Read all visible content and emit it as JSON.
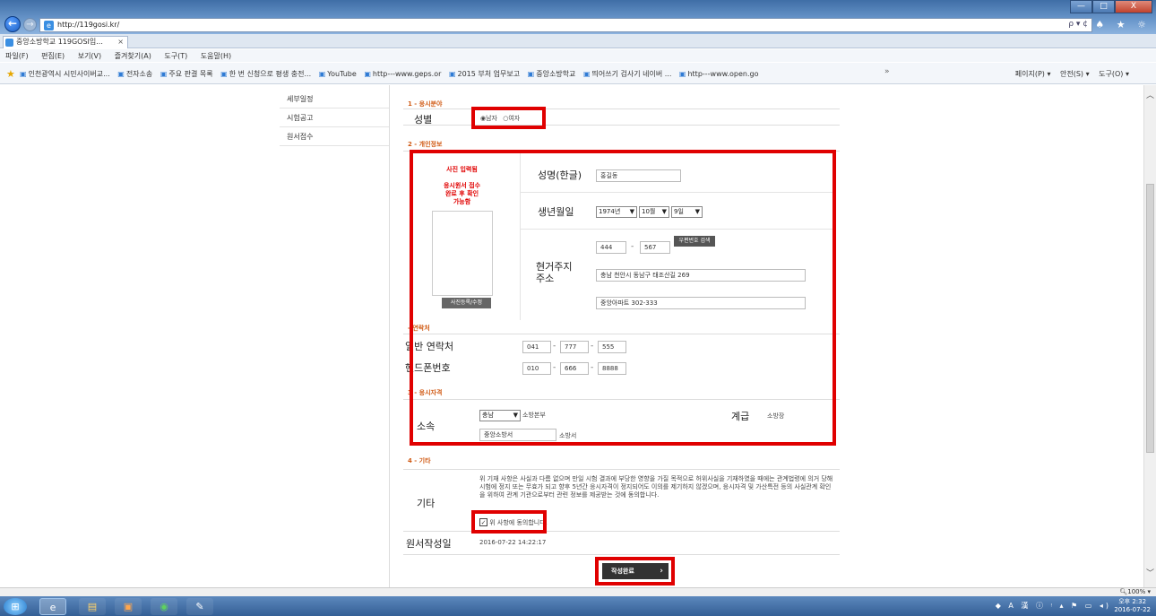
{
  "browser": {
    "url": "http://119gosi.kr/",
    "tab_title": "중앙소방학교 119GOSI입...",
    "tab_close": "×",
    "back_glyph": "←",
    "forward_glyph": "→",
    "addr_tools": "ρ ▾ ¢",
    "right_icons": "♠ ★ ☼",
    "win_min": "—",
    "win_max": "□",
    "win_close": "X",
    "menu": [
      "파일(F)",
      "편집(E)",
      "보기(V)",
      "즐겨찾기(A)",
      "도구(T)",
      "도움말(H)"
    ],
    "favorites": [
      "인천광역시 시민사이버교...",
      "전자소송",
      "주요 판결 목록",
      "한 번 신청으로 평생 충전...",
      "YouTube",
      "http---www.geps.or",
      "2015 부처 업무보고",
      "중앙소방학교",
      "띄어쓰기 검사기 네이버 ...",
      "http---www.open.go"
    ],
    "fav_more": "»",
    "commands": [
      "페이지(P) ▾",
      "안전(S) ▾",
      "도구(O) ▾"
    ]
  },
  "sidebar": {
    "items": [
      {
        "label": "세부일정"
      },
      {
        "label": "시험공고"
      },
      {
        "label": "원서접수"
      }
    ]
  },
  "form": {
    "section1": {
      "title": "1 - 응시분야",
      "gender_label": "성별",
      "gender_options": [
        "남자",
        "여자"
      ],
      "gender_selected": "남자"
    },
    "section2": {
      "title": "2 - 개인정보",
      "photo_note": "사진 입력됨\n\n응시원서 접수\n완료 후 확인\n가능함",
      "photo_button": "사진등록/수정",
      "name_label": "성명(한글)",
      "name_value": "홍길동",
      "birth_label": "생년월일",
      "birth_year": "1974년",
      "birth_month": "10월",
      "birth_day": "9일",
      "address_label": "현거주지\n주소",
      "zip1": "444",
      "zip2": "567",
      "zip_button": "우편번호 검색",
      "address1": "충남 천안시 동남구 태조산길 269",
      "address2": "중앙아파트 302-333"
    },
    "contact": {
      "title": "- 연락처",
      "phone_label": "일반 연락처",
      "phone": [
        "041",
        "777",
        "555"
      ],
      "mobile_label": "핸드폰번호",
      "mobile": [
        "010",
        "666",
        "8888"
      ]
    },
    "section3": {
      "title": "3 - 응시자격",
      "affiliation_label": "소속",
      "province": "충남",
      "hq_suffix": "소방본부",
      "station": "중앙소방서",
      "station_suffix": "소방서",
      "rank_label": "계급",
      "rank_value": "소방장"
    },
    "section4": {
      "title": "4 - 기타",
      "etc_label": "기타",
      "notice": "위 기재 사항은 사실과 다름 없으며 만일 시험 결과에 부당한 영향을 가질 목적으로 허위사실을 기재하였을 때에는 관계법령에 의거 당해 시험에 정지 또는 무효가 되고 향후 5년간 응시자격이 정지되어도 이의를 제기하지 않겠으며, 응시자격 및 가산특전 등의 사실관계 확인을 위하여 관계 기관으로부터 관련 정보를 제공받는 것에 동의합니다.",
      "agree_label": "위 사항에 동의합니다.",
      "agree_checked": true,
      "date_label": "원서작성일",
      "date_value": "2016-07-22 14:22:17"
    },
    "submit_label": "작성완료",
    "submit_arrow": "›"
  },
  "status": {
    "zoom": "100%"
  },
  "taskbar": {
    "tray": "◆ A 漢 ⓘ ᵎ ▴ ⚑ ▭ ◂)",
    "time": "오후 2:32",
    "date": "2016-07-22"
  }
}
